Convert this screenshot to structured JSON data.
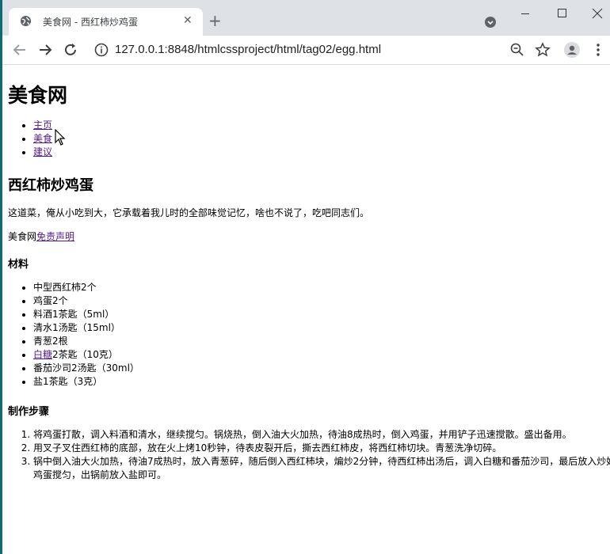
{
  "browser": {
    "tab_title": "美食网 - 西红柿炒鸡蛋",
    "close_tab": "✕",
    "new_tab": "+",
    "url": "127.0.0.1:8848/htmlcssproject/html/tag02/egg.html"
  },
  "page": {
    "site_title": "美食网",
    "nav": [
      "主页",
      "美食",
      "建议"
    ],
    "recipe_title": "西红柿炒鸡蛋",
    "intro": "这道菜，俺从小吃到大，它承载着我儿时的全部味觉记忆，啥也不说了，吃吧同志们。",
    "disclaimer_prefix": "美食网",
    "disclaimer_link": "免责声明",
    "ingredients_heading": "材料",
    "ingredients": [
      {
        "link": "",
        "text": "中型西红柿2个"
      },
      {
        "link": "",
        "text": "鸡蛋2个"
      },
      {
        "link": "",
        "text": "料酒1茶匙（5ml）"
      },
      {
        "link": "",
        "text": "清水1汤匙（15ml）"
      },
      {
        "link": "",
        "text": "青葱2根"
      },
      {
        "link": "白糖",
        "text": "2茶匙（10克）"
      },
      {
        "link": "",
        "text": "番茄沙司2汤匙（30ml）"
      },
      {
        "link": "",
        "text": "盐1茶匙（3克）"
      }
    ],
    "steps_heading": "制作步骤",
    "steps": [
      "将鸡蛋打散，调入料酒和清水，继续搅匀。锅烧热，倒入油大火加热，待油8成热时，倒入鸡蛋，并用铲子迅速搅散。盛出备用。",
      "用叉子叉住西红柿的底部，放在火上烤10秒钟，待表皮裂开后，撕去西红柿皮，将西红柿切块。青葱洗净切碎。",
      "锅中倒入油大火加热，待油7成热时，放入青葱碎，随后倒入西红柿块，煸炒2分钟，待西红柿出汤后，调入白糖和番茄沙司，最后放入炒好的鸡蛋搅匀，出锅前放入盐即可。"
    ]
  }
}
